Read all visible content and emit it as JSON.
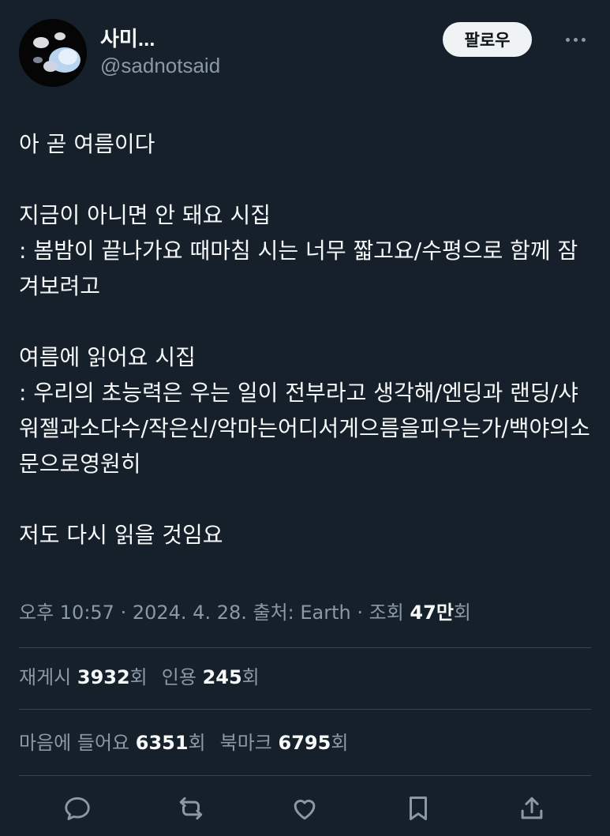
{
  "profile": {
    "display_name": "사미...",
    "handle": "@sadnotsaid"
  },
  "follow_button": {
    "label": "팔로우"
  },
  "tweet": {
    "lines": [
      "아 곧 여름이다",
      "",
      "지금이 아니면 안 돼요 시집",
      ": 봄밤이 끝나가요 때마침 시는 너무 짧고요/수평으로 함께 잠겨보려고",
      "",
      "여름에 읽어요 시집",
      ": 우리의 초능력은 우는 일이 전부라고 생각해/엔딩과 랜딩/샤워젤과소다수/작은신/악마는어디서게으름을피우는가/백야의소문으로영원히",
      "",
      "저도 다시 읽을 것임요"
    ]
  },
  "meta": {
    "prefix": "오후 10:57 · 2024. 4. 28. 출처: Earth · 조회 ",
    "views": "47만",
    "views_suffix": "회"
  },
  "stats": {
    "retweets_label": "재게시 ",
    "retweets": "3932",
    "retweets_suffix": "회",
    "quotes_label": "인용 ",
    "quotes": "245",
    "quotes_suffix": "회",
    "likes_label": "마음에 들어요 ",
    "likes": "6351",
    "likes_suffix": "회",
    "bookmarks_label": "북마크 ",
    "bookmarks": "6795",
    "bookmarks_suffix": "회"
  },
  "actions": [
    "reply-icon",
    "retweet-icon",
    "like-icon",
    "bookmark-icon",
    "share-icon"
  ],
  "colors": {
    "background": "#15202b",
    "text": "#f7f9f9",
    "muted": "#8b98a5",
    "divider": "#38444d",
    "follow_bg": "#eff3f4"
  }
}
